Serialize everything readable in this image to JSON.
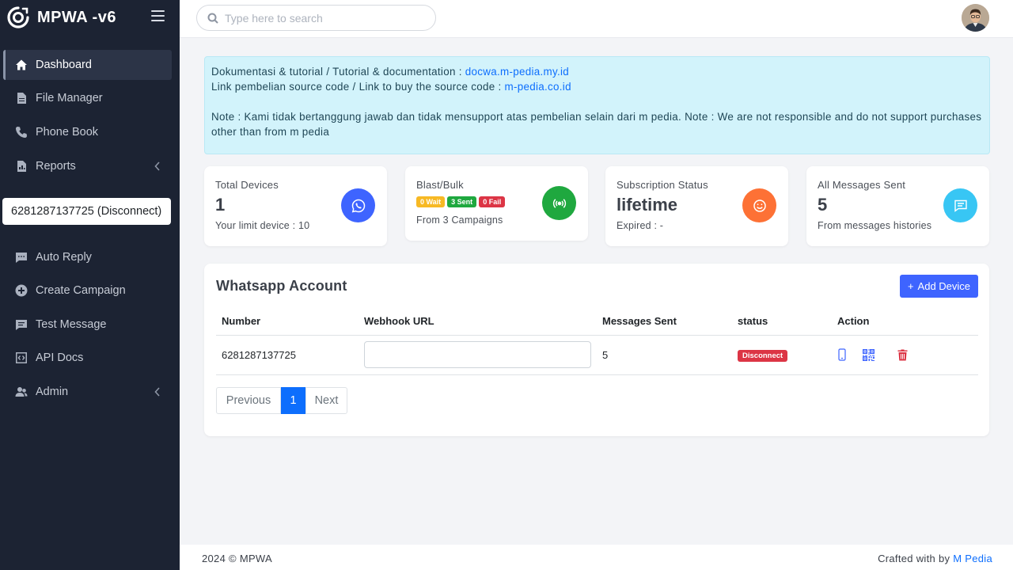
{
  "app": {
    "name": "MPWA -v6"
  },
  "sidebar": {
    "items": [
      {
        "label": "Dashboard",
        "icon": "home-icon",
        "active": true
      },
      {
        "label": "File Manager",
        "icon": "file-icon"
      },
      {
        "label": "Phone Book",
        "icon": "phone-icon"
      },
      {
        "label": "Reports",
        "icon": "report-icon",
        "has_submenu": true
      },
      {
        "label": "Auto Reply",
        "icon": "chat-dots-icon"
      },
      {
        "label": "Create Campaign",
        "icon": "plus-circle-icon"
      },
      {
        "label": "Test Message",
        "icon": "chat-icon"
      },
      {
        "label": "API Docs",
        "icon": "code-icon"
      },
      {
        "label": "Admin",
        "icon": "users-icon",
        "has_submenu": true
      }
    ],
    "device_select": "6281287137725 (Disconnect)"
  },
  "topbar": {
    "search_placeholder": "Type here to search"
  },
  "notice": {
    "line1_text": "Dokumentasi & tutorial / Tutorial & documentation : ",
    "line1_link": "docwa.m-pedia.my.id",
    "line2_text": "Link pembelian source code / Link to buy the source code : ",
    "line2_link": "m-pedia.co.id",
    "note": "Note : Kami tidak bertanggung jawab dan tidak mensupport atas pembelian selain dari m pedia. Note : We are not responsible and do not support purchases other than from m pedia"
  },
  "stats": {
    "devices": {
      "label": "Total Devices",
      "value": "1",
      "sub": "Your limit device : 10",
      "color": "#3e64ff"
    },
    "blast": {
      "label": "Blast/Bulk",
      "wait": "0 Wait",
      "sent": "3 Sent",
      "fail": "0 Fail",
      "sub": "From 3 Campaigns",
      "color": "#1fa83f"
    },
    "subscription": {
      "label": "Subscription Status",
      "value": "lifetime",
      "sub": "Expired : -",
      "color": "#fd7135"
    },
    "messages": {
      "label": "All Messages Sent",
      "value": "5",
      "sub": "From messages histories",
      "color": "#38c6f4"
    }
  },
  "accounts": {
    "title": "Whatsapp Account",
    "add_button": "Add Device",
    "columns": [
      "Number",
      "Webhook URL",
      "Messages Sent",
      "status",
      "Action"
    ],
    "rows": [
      {
        "number": "6281287137725",
        "webhook": "",
        "messages_sent": "5",
        "status": "Disconnect"
      }
    ],
    "pager": {
      "previous": "Previous",
      "current": "1",
      "next": "Next"
    }
  },
  "footer": {
    "left": "2024 © MPWA",
    "right_text": "Crafted with by ",
    "right_link": "M Pedia"
  }
}
